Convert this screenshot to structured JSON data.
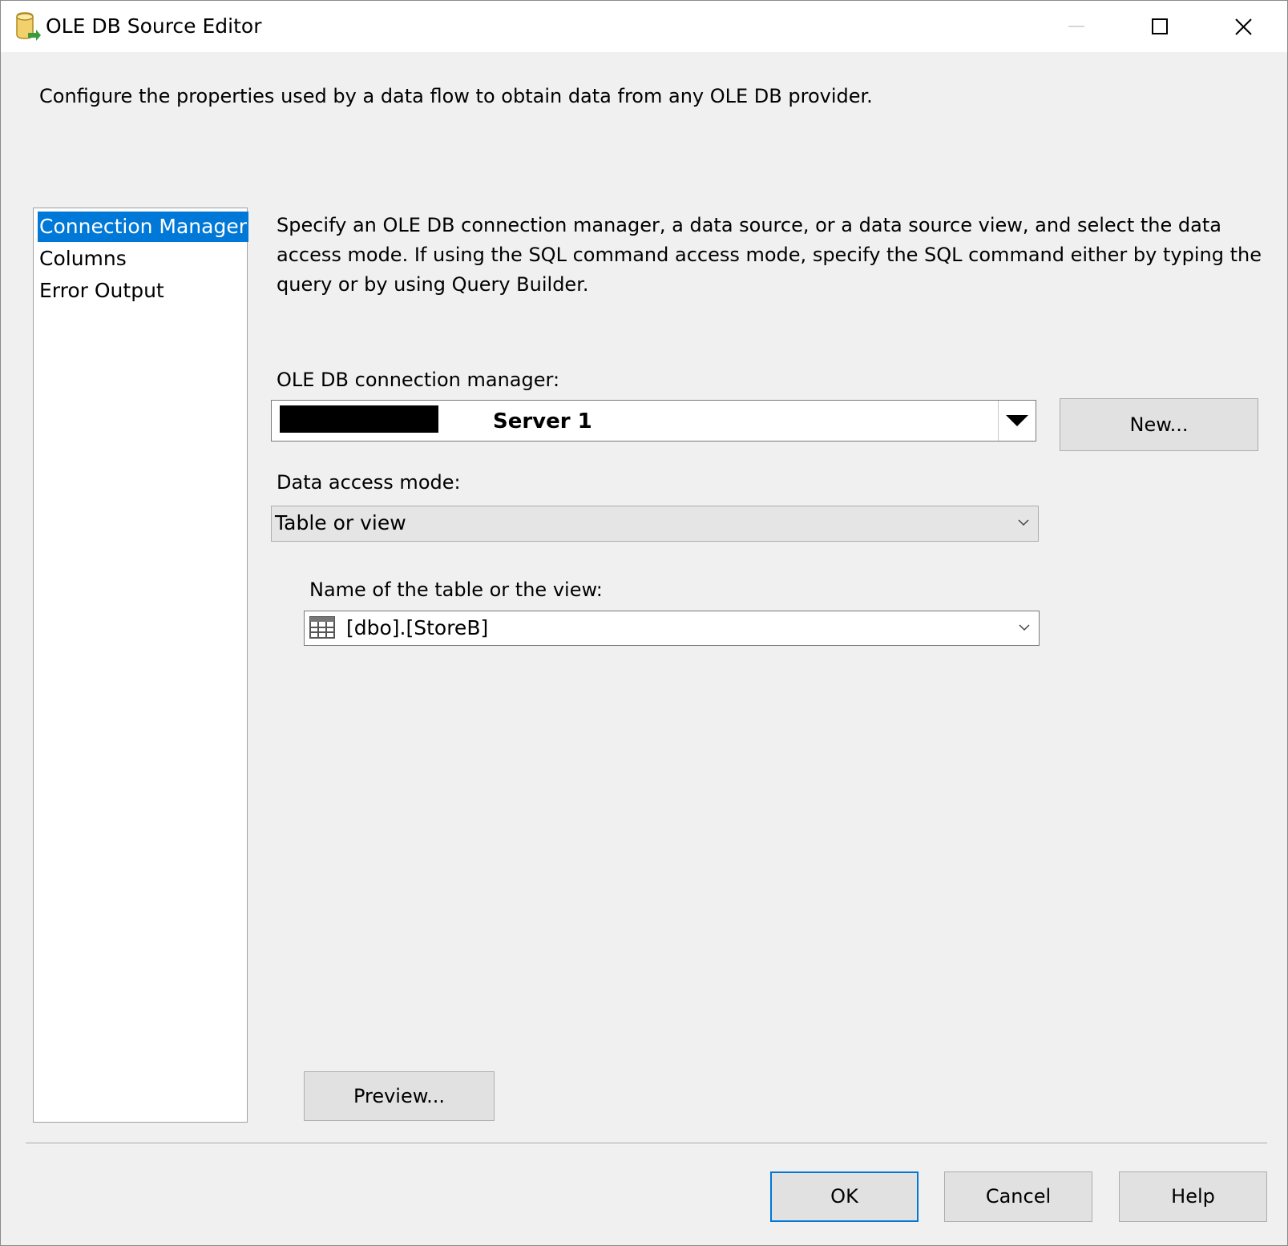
{
  "window": {
    "title": "OLE DB Source Editor",
    "icon": "database-cylinder-icon"
  },
  "top_description": "Configure the properties used by a data flow to obtain data from any OLE DB provider.",
  "nav": {
    "items": [
      {
        "label": "Connection Manager",
        "selected": true
      },
      {
        "label": "Columns",
        "selected": false
      },
      {
        "label": "Error Output",
        "selected": false
      }
    ]
  },
  "panel": {
    "description": "Specify an OLE DB connection manager, a data source, or a data source view, and select the data access mode. If using the SQL command access mode, specify the SQL command either by typing the query or by using Query Builder.",
    "connection_label": "OLE DB connection manager:",
    "connection_value": "Server 1",
    "new_button": "New...",
    "access_mode_label": "Data access mode:",
    "access_mode_value": "Table or view",
    "table_label": "Name of the table or the view:",
    "table_value": "[dbo].[StoreB]",
    "preview_button": "Preview..."
  },
  "footer": {
    "ok": "OK",
    "cancel": "Cancel",
    "help": "Help"
  },
  "colors": {
    "selection": "#0078d7",
    "dialog_bg": "#f0f0f0",
    "button_bg": "#e1e1e1"
  }
}
